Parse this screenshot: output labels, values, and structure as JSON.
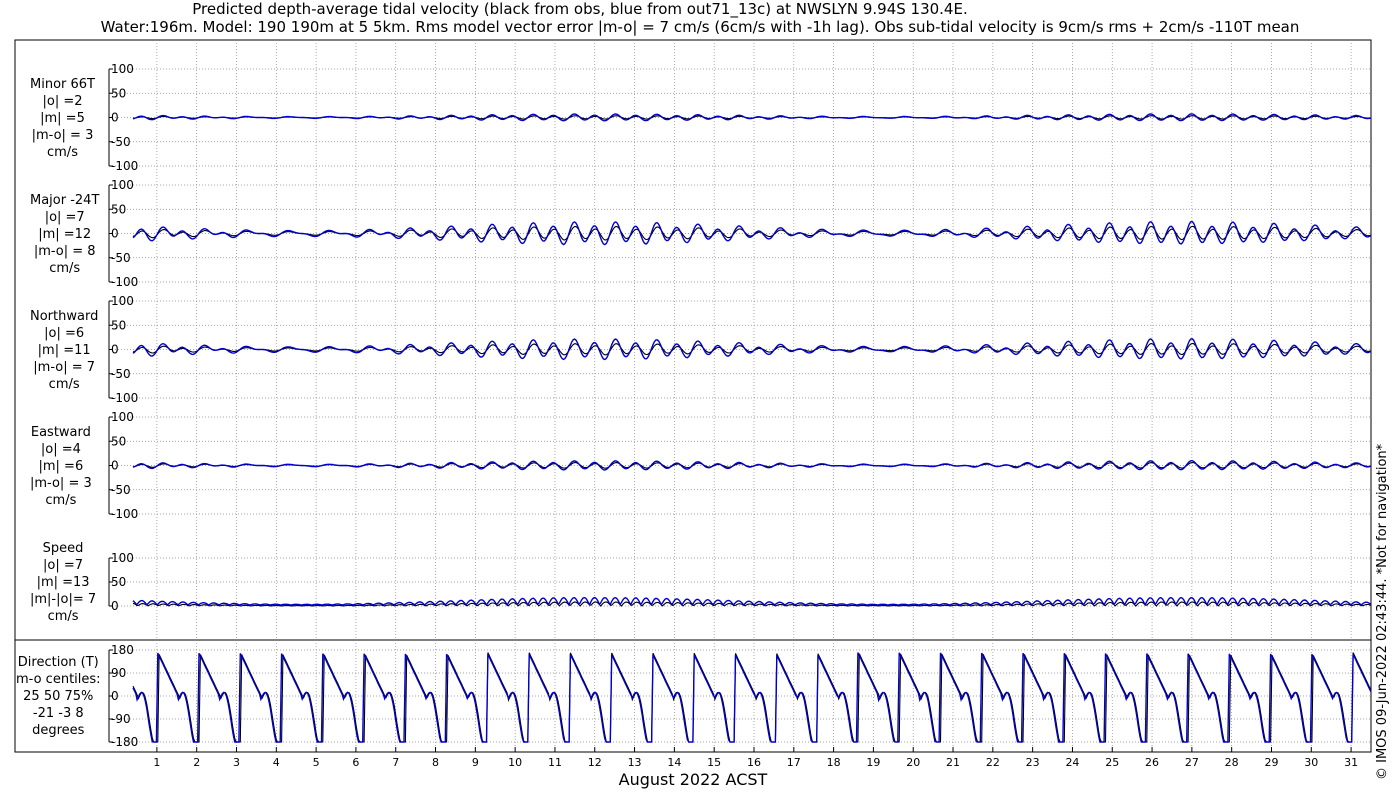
{
  "title_line1": "Predicted depth-average tidal velocity (black from obs, blue from out71_13c) at NWSLYN 9.94S 130.4E.",
  "title_line2": "Water:196m. Model: 190 190m at 5 5km. Rms model vector error |m-o| = 7 cm/s (6cm/s with -1h lag). Obs sub-tidal velocity is 9cm/s rms + 2cm/s -110T mean",
  "credit": "© IMOS 09-Jun-2022 02:43:44. *Not for navigation*",
  "xlabel": "August 2022 ACST",
  "panels": [
    {
      "label": [
        "Minor 66T",
        "|o| =2",
        "|m| =5",
        "|m-o| = 3",
        "cm/s"
      ]
    },
    {
      "label": [
        "Major -24T",
        "|o| =7",
        "|m| =12",
        "|m-o| = 8",
        "cm/s"
      ]
    },
    {
      "label": [
        "Northward",
        "|o| =6",
        "|m| =11",
        "|m-o| = 7",
        "cm/s"
      ]
    },
    {
      "label": [
        "Eastward",
        "|o| =4",
        "|m| =6",
        "|m-o| = 3",
        "cm/s"
      ]
    },
    {
      "label": [
        "Speed",
        "|o| =7",
        "|m| =13",
        "|m|-|o|= 7",
        "cm/s"
      ]
    },
    {
      "label": [
        "Direction (T)",
        "m-o centiles:",
        "25  50  75%",
        "-21  -3   8",
        "degrees"
      ]
    }
  ],
  "colors": {
    "obs": "#000000",
    "model": "#0000cc",
    "grid": "#888888"
  },
  "chart_data": [
    {
      "type": "line",
      "title": "Minor 66T",
      "xlabel": "August 2022 ACST",
      "x_ticks": [
        1,
        2,
        3,
        4,
        5,
        6,
        7,
        8,
        9,
        10,
        11,
        12,
        13,
        14,
        15,
        16,
        17,
        18,
        19,
        20,
        21,
        22,
        23,
        24,
        25,
        26,
        27,
        28,
        29,
        30,
        31
      ],
      "xlim": [
        0.4,
        31.5
      ],
      "ylim": [
        -100,
        100
      ],
      "y_ticks": [
        -100,
        -50,
        0,
        50,
        100
      ],
      "series": [
        {
          "name": "obs",
          "amplitude_cm_s": 3
        },
        {
          "name": "model",
          "amplitude_cm_s": 6
        }
      ],
      "grid": true
    },
    {
      "type": "line",
      "title": "Major -24T",
      "xlim": [
        0.4,
        31.5
      ],
      "ylim": [
        -100,
        100
      ],
      "y_ticks": [
        -100,
        -50,
        0,
        50,
        100
      ],
      "series": [
        {
          "name": "obs",
          "amplitude_cm_s": 12
        },
        {
          "name": "model",
          "amplitude_cm_s": 20
        }
      ],
      "grid": true
    },
    {
      "type": "line",
      "title": "Northward",
      "xlim": [
        0.4,
        31.5
      ],
      "ylim": [
        -100,
        100
      ],
      "y_ticks": [
        -100,
        -50,
        0,
        50,
        100
      ],
      "series": [
        {
          "name": "obs",
          "amplitude_cm_s": 10
        },
        {
          "name": "model",
          "amplitude_cm_s": 18
        }
      ],
      "grid": true
    },
    {
      "type": "line",
      "title": "Eastward",
      "xlim": [
        0.4,
        31.5
      ],
      "ylim": [
        -100,
        100
      ],
      "y_ticks": [
        -100,
        -50,
        0,
        50,
        100
      ],
      "series": [
        {
          "name": "obs",
          "amplitude_cm_s": 5
        },
        {
          "name": "model",
          "amplitude_cm_s": 8
        }
      ],
      "grid": true
    },
    {
      "type": "line",
      "title": "Speed",
      "xlim": [
        0.4,
        31.5
      ],
      "ylim": [
        0,
        100
      ],
      "y_ticks": [
        0,
        50,
        100
      ],
      "series": [
        {
          "name": "obs",
          "mean_cm_s": 7
        },
        {
          "name": "model",
          "mean_cm_s": 13
        }
      ],
      "grid": true
    },
    {
      "type": "line",
      "title": "Direction (T)",
      "xlim": [
        0.4,
        31.5
      ],
      "ylim": [
        -180,
        180
      ],
      "y_ticks": [
        -180,
        -90,
        0,
        90,
        180
      ],
      "series": [
        {
          "name": "obs"
        },
        {
          "name": "model"
        }
      ],
      "grid": true
    }
  ]
}
